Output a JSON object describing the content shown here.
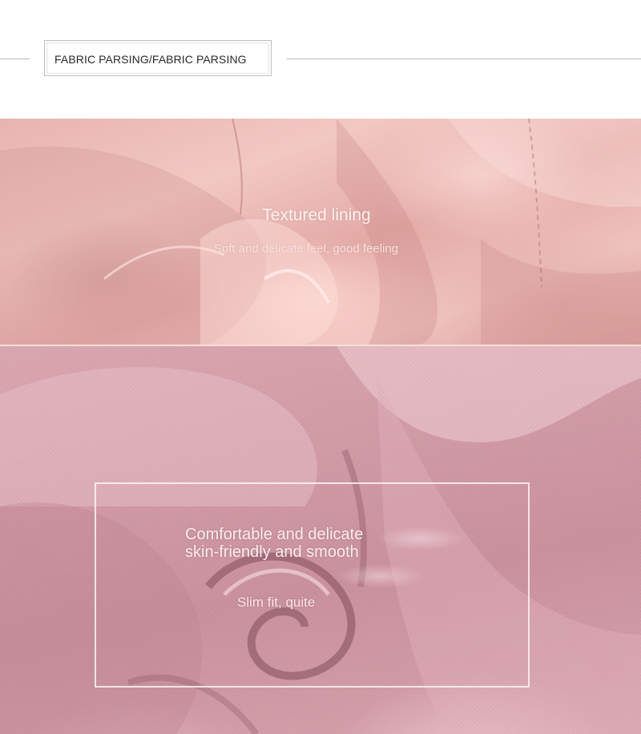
{
  "header": {
    "title": "FABRIC PARSING/FABRIC PARSING"
  },
  "lining_panel": {
    "title": "Textured lining",
    "subtitle": "Soft and delicate feel, good feeling"
  },
  "crepe_panel": {
    "heading_line1": "Comfortable and delicate",
    "heading_line2": "skin-friendly and smooth",
    "subtitle": "Slim fit, quite"
  },
  "colors": {
    "lining_pink": "#ebb9b4",
    "crepe_pink": "#d29ca6",
    "frame_border": "#fff4f6",
    "header_rule": "#b9b9b9"
  }
}
